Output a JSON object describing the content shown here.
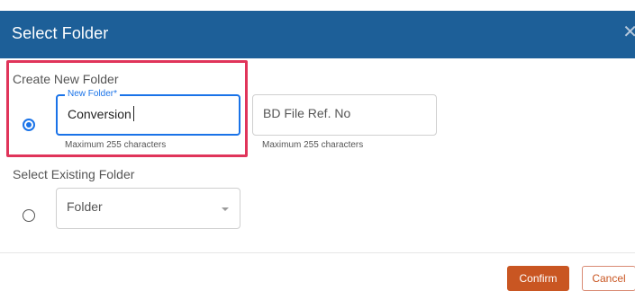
{
  "dialog": {
    "title": "Select Folder",
    "close_icon": "close-icon"
  },
  "create_new": {
    "section_label": "Create New Folder",
    "selected": true,
    "folder_field": {
      "label": "New Folder*",
      "value": "Conversion",
      "helper": "Maximum 255 characters"
    },
    "ref_field": {
      "placeholder": "BD File Ref. No",
      "helper": "Maximum 255 characters"
    }
  },
  "select_existing": {
    "section_label": "Select Existing Folder",
    "selected": false,
    "folder_dropdown": {
      "placeholder": "Folder"
    }
  },
  "footer": {
    "confirm_label": "Confirm",
    "cancel_label": "Cancel"
  },
  "colors": {
    "header_bg": "#1d5f98",
    "accent": "#1a73e8",
    "primary_button": "#c95622",
    "highlight": "#e0345a"
  }
}
